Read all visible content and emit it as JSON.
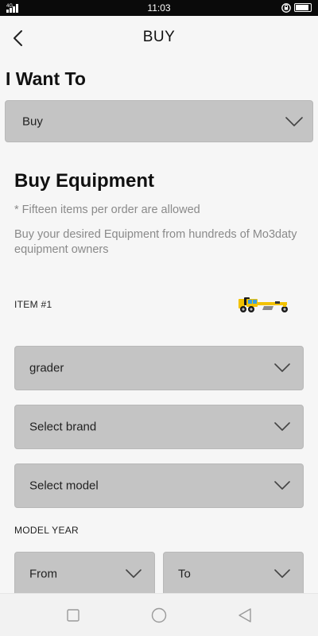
{
  "status_bar": {
    "time": "11:03",
    "network": "4G"
  },
  "header": {
    "title": "BUY"
  },
  "want": {
    "heading": "I Want To",
    "selected": "Buy"
  },
  "buy": {
    "title": "Buy Equipment",
    "note": "* Fifteen items per order are allowed",
    "description": "Buy your desired Equipment from hundreds of Mo3daty equipment owners"
  },
  "item": {
    "label": "ITEM #1",
    "equipment_type": "grader",
    "brand_placeholder": "Select brand",
    "model_placeholder": "Select model",
    "model_year_label": "MODEL YEAR",
    "year_from": "From",
    "year_to": "To"
  },
  "icons": {
    "back": "chevron-left-icon",
    "dropdown": "chevron-down-icon",
    "equipment": "grader-image",
    "nav_recent": "square-icon",
    "nav_home": "circle-icon",
    "nav_back": "triangle-icon"
  },
  "colors": {
    "select_bg": "#c4c4c4",
    "hint_text": "#8a8a8a",
    "status_bar": "#0a0a0a",
    "machine_yellow": "#f2c200"
  }
}
